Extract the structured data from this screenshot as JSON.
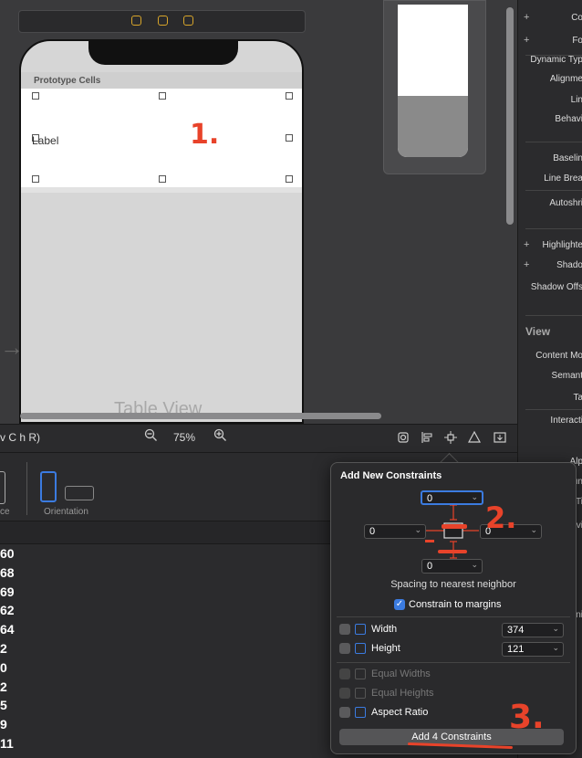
{
  "canvas": {
    "prototype_cells": "Prototype Cells",
    "cell_label": "Label",
    "table_view_label": "Table View",
    "annotation_1": "1."
  },
  "toolbar": {
    "view_as": "v C  h R)",
    "zoom_level": "75%",
    "zoom_out_icon": "magnifier-minus-icon",
    "zoom_in_icon": "magnifier-plus-icon"
  },
  "device_bar": {
    "device_label": "ce",
    "orientation_label": "Orientation"
  },
  "numbers": [
    "60",
    "68",
    "69",
    "62",
    "64",
    "2",
    "0",
    "2",
    "5",
    "9",
    "11"
  ],
  "inspector": {
    "rows": [
      "Co",
      "Fo",
      "Dynamic Typ",
      "Alignme",
      "Lin",
      "Behavi",
      "Baselin",
      "Line Brea",
      "Autoshri",
      "Highlighte",
      "Shado",
      "Shadow Offs",
      "View",
      "Content Mo",
      "Semant",
      "Ta",
      "Interacti",
      "Alp",
      "un",
      "Ti",
      "vi",
      "ni"
    ]
  },
  "popover": {
    "title": "Add New Constraints",
    "top_value": "0",
    "left_value": "0",
    "right_value": "0",
    "bottom_value": "0",
    "spacing_label": "Spacing to nearest neighbor",
    "constrain_margins": "Constrain to margins",
    "width_label": "Width",
    "width_value": "374",
    "height_label": "Height",
    "height_value": "121",
    "equal_widths": "Equal Widths",
    "equal_heights": "Equal Heights",
    "aspect_ratio": "Aspect Ratio",
    "add_button": "Add 4 Constraints",
    "annotation_2": "2.",
    "annotation_3": "3."
  },
  "colors": {
    "accent": "#3b7be0",
    "annotation": "#e8432a",
    "scene_icon": "#d7a52a"
  }
}
